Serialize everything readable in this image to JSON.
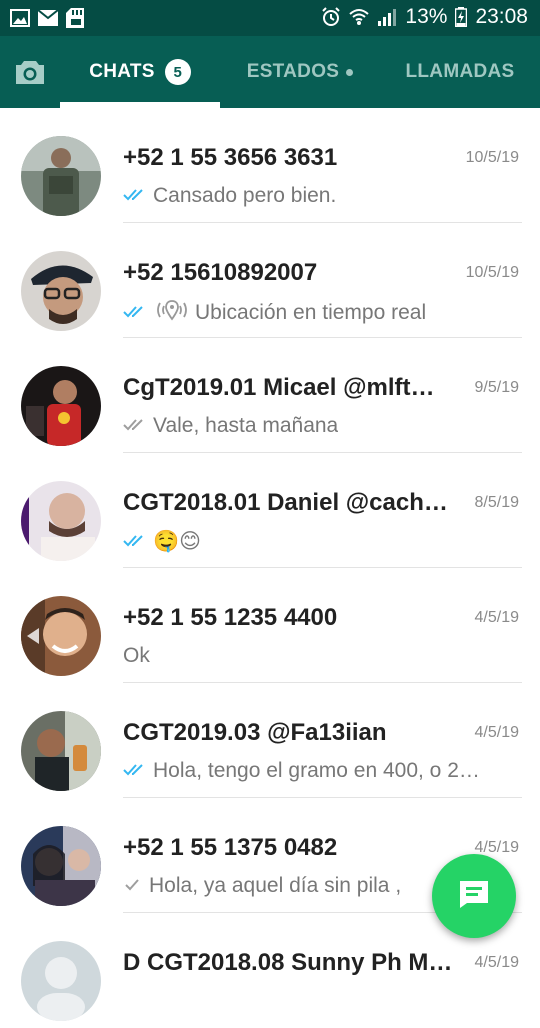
{
  "status_bar": {
    "icons_left": [
      "image-icon",
      "mail-icon",
      "sd-card-icon"
    ],
    "icons_right": [
      "alarm-icon",
      "wifi-icon",
      "signal-icon",
      "battery-icon"
    ],
    "battery_percent": "13%",
    "time": "23:08"
  },
  "header": {
    "camera_icon": "camera-icon",
    "tabs": [
      {
        "label": "CHATS",
        "badge": "5",
        "active": true
      },
      {
        "label": "ESTADOS",
        "has_dot": true,
        "active": false
      },
      {
        "label": "LLAMADAS",
        "active": false
      }
    ]
  },
  "chats": [
    {
      "name": "+52 1 55 3656 3631",
      "date": "10/5/19",
      "ticks": "double-blue",
      "message": "Cansado pero bien."
    },
    {
      "name": "+52 15610892007",
      "date": "10/5/19",
      "ticks": "double-blue",
      "location": true,
      "message": "Ubicación en tiempo real"
    },
    {
      "name": "CgT2019.01 Micael @mlft…",
      "date": "9/5/19",
      "ticks": "double-grey",
      "message": "Vale, hasta mañana"
    },
    {
      "name": "CGT2018.01 Daniel @cach…",
      "date": "8/5/19",
      "ticks": "double-blue",
      "message": "🤤😊"
    },
    {
      "name": "+52 1 55 1235 4400",
      "date": "4/5/19",
      "ticks": "none",
      "message": "Ok"
    },
    {
      "name": "CGT2019.03 @Fa13iian",
      "date": "4/5/19",
      "ticks": "double-blue",
      "message": "Hola, tengo el gramo en 400, o 2…"
    },
    {
      "name": "+52 1 55 1375 0482",
      "date": "4/5/19",
      "ticks": "single-grey",
      "message": "Hola, ya aquel día sin pila ,"
    },
    {
      "name": "D CGT2018.08 Sunny Ph M…",
      "date": "4/5/19",
      "ticks": "none",
      "message": ""
    }
  ],
  "fab": {
    "icon": "new-chat-message-icon"
  },
  "colors": {
    "header": "#075e54",
    "status_bar": "#054c44",
    "fab": "#25d366",
    "tick_blue": "#34b7f1",
    "tick_grey": "#9e9e9e"
  }
}
